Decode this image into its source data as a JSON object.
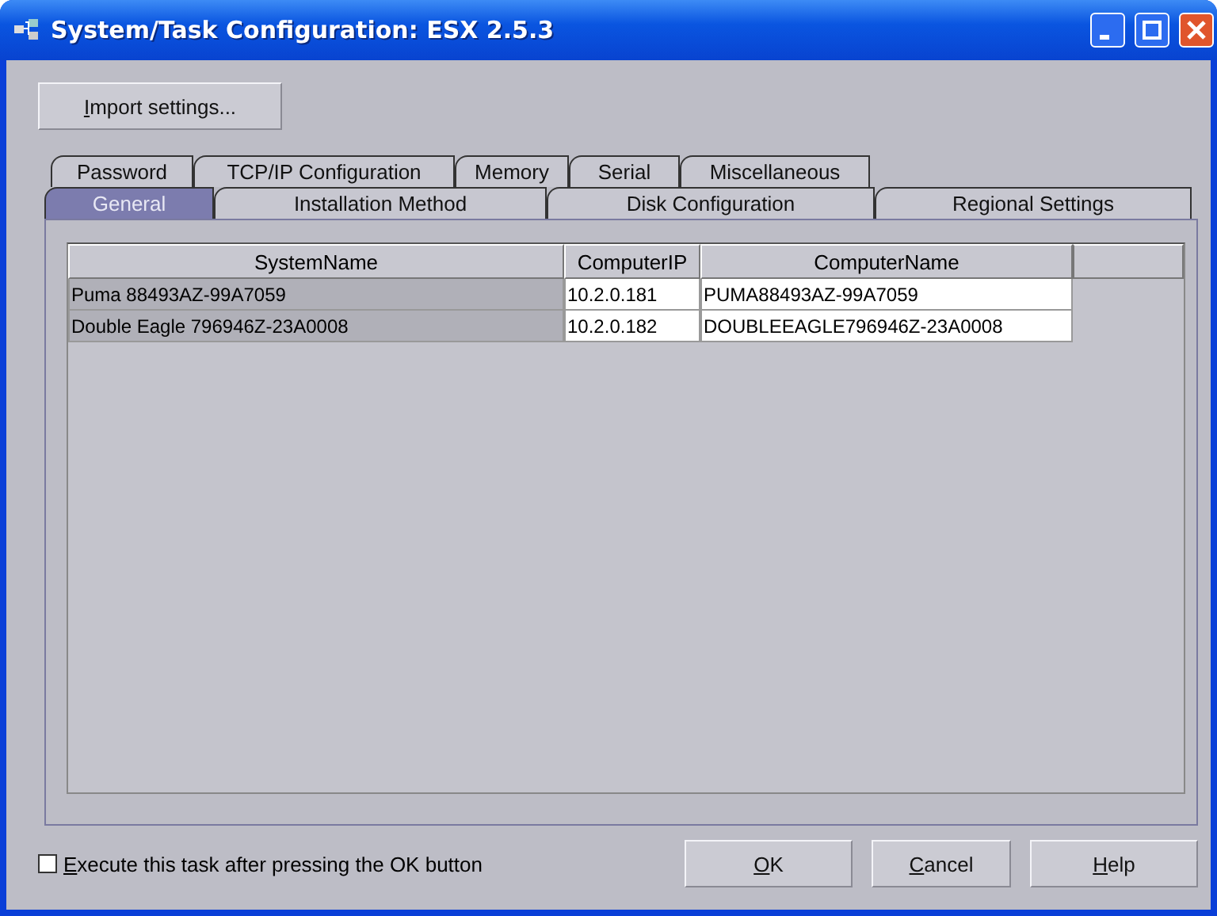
{
  "window": {
    "title": "System/Task Configuration: ESX 2.5.3"
  },
  "import_button": {
    "label": "Import settings..."
  },
  "tab_rows": [
    [
      {
        "label": "Password",
        "selected": false
      },
      {
        "label": "TCP/IP Configuration",
        "selected": false
      },
      {
        "label": "Memory",
        "selected": false
      },
      {
        "label": "Serial",
        "selected": false
      },
      {
        "label": "Miscellaneous",
        "selected": false
      }
    ],
    [
      {
        "label": "General",
        "selected": true
      },
      {
        "label": "Installation Method",
        "selected": false
      },
      {
        "label": "Disk Configuration",
        "selected": false
      },
      {
        "label": "Regional Settings",
        "selected": false
      }
    ]
  ],
  "table": {
    "columns": [
      {
        "label": "SystemName",
        "editable": false
      },
      {
        "label": "ComputerIP",
        "editable": true
      },
      {
        "label": "ComputerName",
        "editable": true
      }
    ],
    "rows": [
      [
        "Puma 88493AZ-99A7059",
        "10.2.0.181",
        "PUMA88493AZ-99A7059"
      ],
      [
        "Double Eagle 796946Z-23A0008",
        "10.2.0.182",
        "DOUBLEEAGLE796946Z-23A0008"
      ]
    ]
  },
  "execute_checkbox": {
    "label": "Execute this task after pressing the OK button",
    "checked": false
  },
  "buttons": [
    "OK",
    "Cancel",
    "Help"
  ]
}
